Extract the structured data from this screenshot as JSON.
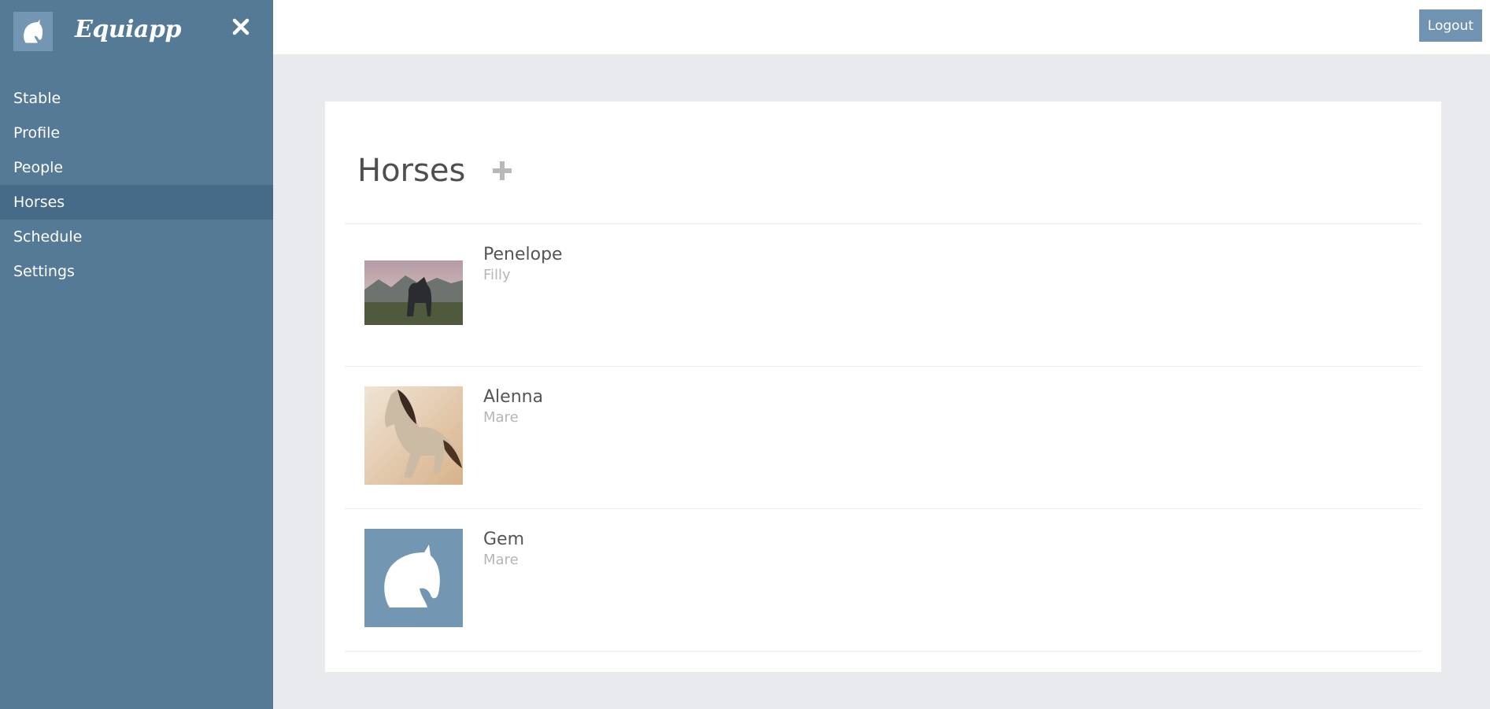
{
  "app": {
    "name": "Equiapp"
  },
  "sidebar": {
    "items": [
      {
        "label": "Stable",
        "active": false
      },
      {
        "label": "Profile",
        "active": false
      },
      {
        "label": "People",
        "active": false
      },
      {
        "label": "Horses",
        "active": true
      },
      {
        "label": "Schedule",
        "active": false
      },
      {
        "label": "Settings",
        "active": false
      }
    ]
  },
  "topbar": {
    "logout_label": "Logout"
  },
  "main": {
    "title": "Horses",
    "horses": [
      {
        "name": "Penelope",
        "type": "Filly",
        "image": "photo-dark-horse"
      },
      {
        "name": "Alenna",
        "type": "Mare",
        "image": "photo-buckskin-horse"
      },
      {
        "name": "Gem",
        "type": "Mare",
        "image": "placeholder-horse-icon"
      }
    ]
  },
  "colors": {
    "sidebar_bg": "#557a96",
    "sidebar_active": "#456b88",
    "accent": "#6f93b0",
    "page_bg": "#e8eaee"
  }
}
